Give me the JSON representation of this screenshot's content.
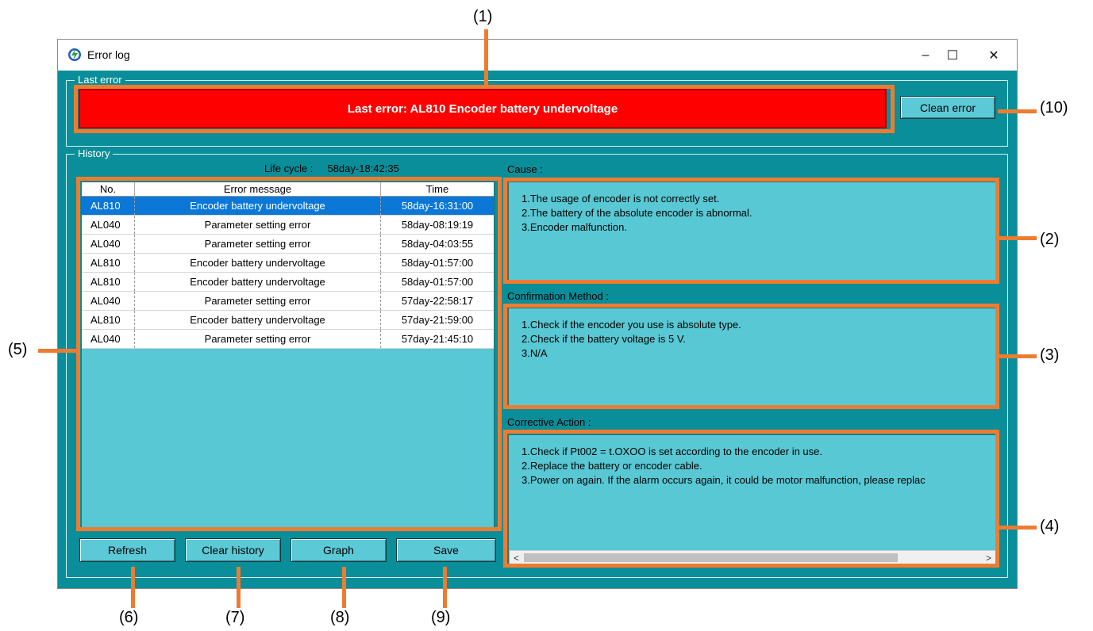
{
  "callouts": [
    "(1)",
    "(2)",
    "(3)",
    "(4)",
    "(5)",
    "(6)",
    "(7)",
    "(8)",
    "(9)",
    "(10)"
  ],
  "window": {
    "title": "Error log",
    "minimize_glyph": "–",
    "maximize_glyph": "☐",
    "close_glyph": "✕"
  },
  "last_error": {
    "group_label": "Last error",
    "text": "Last error: AL810 Encoder battery undervoltage",
    "clean_button": "Clean error",
    "color": "#ff0000"
  },
  "history": {
    "group_label": "History",
    "life_cycle": "Life cycle :     58day-18:42:35",
    "columns": [
      "No.",
      "Error message",
      "Time"
    ],
    "rows": [
      {
        "no": "AL810",
        "message": "Encoder battery undervoltage",
        "time": "58day-16:31:00",
        "selected": true
      },
      {
        "no": "AL040",
        "message": "Parameter setting error",
        "time": "58day-08:19:19"
      },
      {
        "no": "AL040",
        "message": "Parameter setting error",
        "time": "58day-04:03:55"
      },
      {
        "no": "AL810",
        "message": "Encoder battery undervoltage",
        "time": "58day-01:57:00"
      },
      {
        "no": "AL810",
        "message": "Encoder battery undervoltage",
        "time": "58day-01:57:00"
      },
      {
        "no": "AL040",
        "message": "Parameter setting error",
        "time": "57day-22:58:17"
      },
      {
        "no": "AL810",
        "message": "Encoder battery undervoltage",
        "time": "57day-21:59:00"
      },
      {
        "no": "AL040",
        "message": "Parameter setting error",
        "time": "57day-21:45:10"
      }
    ],
    "buttons": {
      "refresh": "Refresh",
      "clear_history": "Clear history",
      "graph": "Graph",
      "save": "Save"
    }
  },
  "cause": {
    "label": "Cause :",
    "lines": [
      "1.The usage of encoder is not correctly set.",
      "2.The battery of the absolute encoder is abnormal.",
      "3.Encoder malfunction."
    ]
  },
  "confirmation": {
    "label": "Confirmation Method :",
    "lines": [
      "1.Check if the encoder you use is absolute type.",
      "2.Check if the battery voltage is 5 V.",
      "3.N/A"
    ]
  },
  "corrective": {
    "label": "Corrective Action :",
    "lines": [
      "1.Check if Pt002 = t.OXOO is set according to the encoder in use.",
      "2.Replace the battery or encoder cable.",
      "3.Power on again. If the alarm occurs again, it could be motor malfunction, please replac"
    ],
    "scroll_left": "<",
    "scroll_right": ">"
  },
  "colors": {
    "window_bg": "#0a8e99",
    "panel_bg": "#58c8d4",
    "annotation": "#ee7c30",
    "selection": "#0b78d7"
  }
}
